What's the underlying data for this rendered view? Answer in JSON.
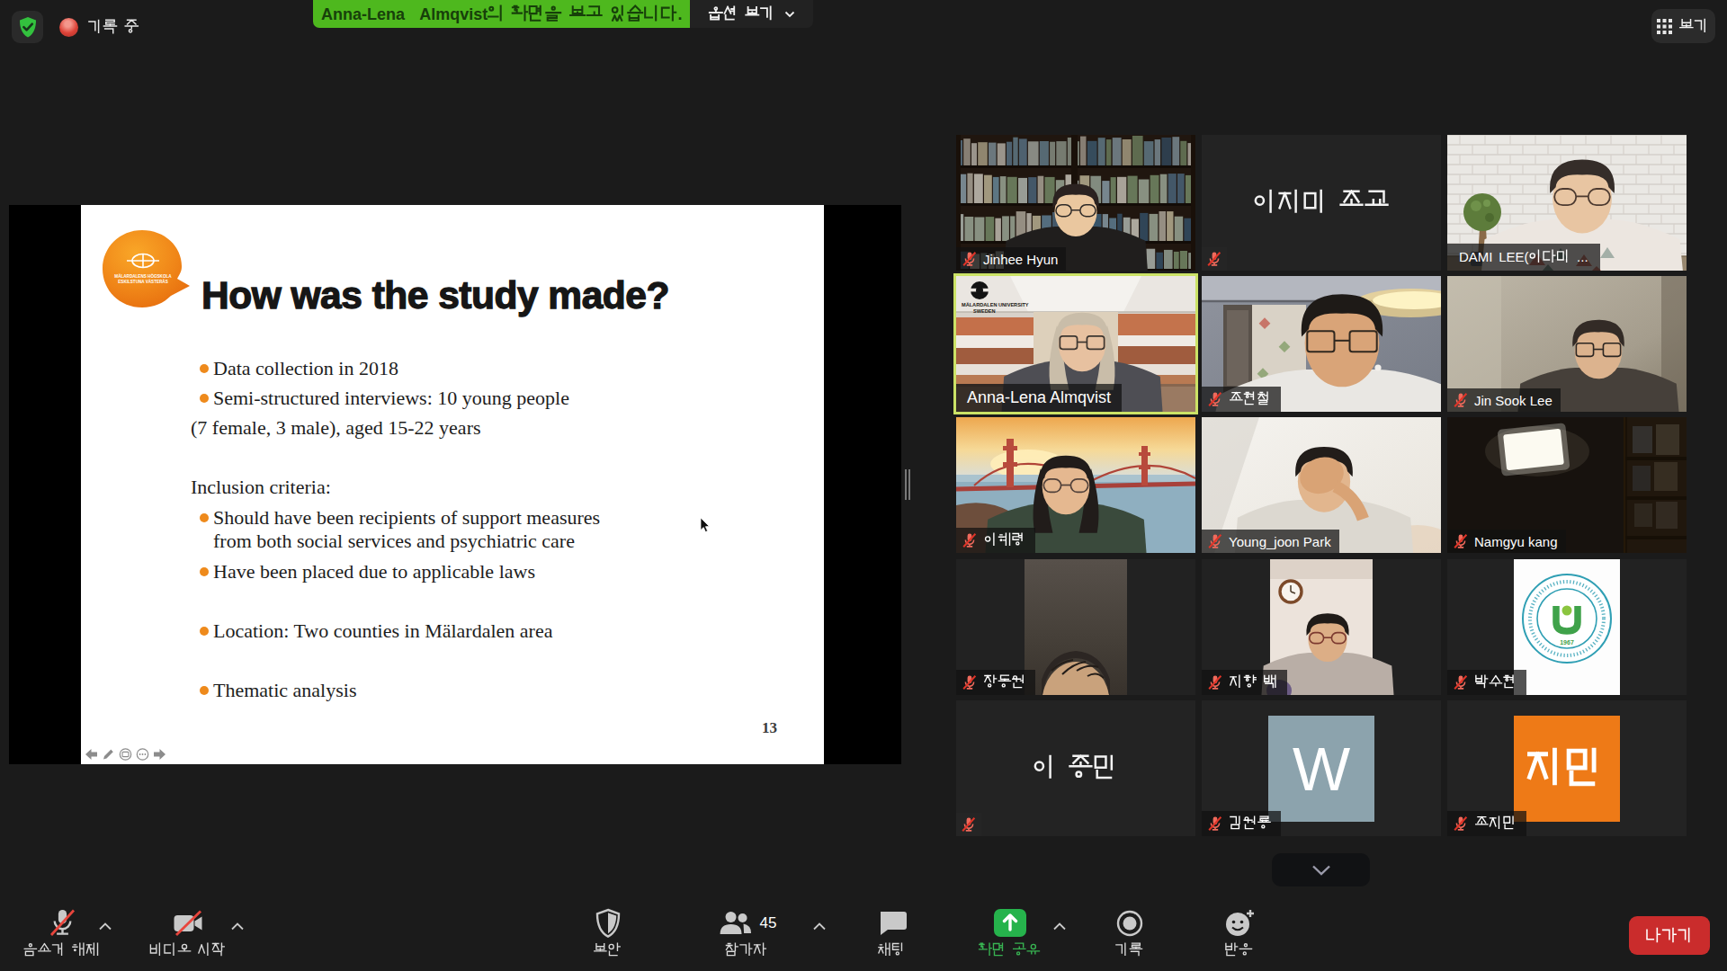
{
  "topbar": {
    "security_icon": "green-shield-check",
    "recording_label": "기록 중",
    "share_banner_text": "Anna-Lena  Almqvist의 화면을 보고 있습니다.",
    "view_options_label": "옵션 보기",
    "view_label": "보기"
  },
  "slide": {
    "logo": {
      "name": "malardalen-hogskola-logo",
      "color": "#ee7d14",
      "lines": [
        "MÄLARDALENS HÖGSKOLA",
        "ESKILSTUNA VÄSTERÅS"
      ]
    },
    "title": "How was the study made?",
    "lines": [
      {
        "bullet": true,
        "text": "Data collection in 2018"
      },
      {
        "bullet": true,
        "text": "Semi-structured interviews: 10 young people"
      },
      {
        "bullet": false,
        "text": "(7 female, 3 male), aged 15-22 years"
      },
      {
        "bullet": false,
        "text": "Inclusion criteria:"
      },
      {
        "bullet": true,
        "text": "Should have been recipients of support measures"
      },
      {
        "bullet": false,
        "text": "from both social services and psychiatric care"
      },
      {
        "bullet": true,
        "text": "Have been placed due to applicable laws"
      },
      {
        "bullet": true,
        "text": "Location: Two counties in Mälardalen area"
      },
      {
        "bullet": true,
        "text": "Thematic analysis"
      }
    ],
    "page_number": "13",
    "nav_icons": [
      "back-arrow-icon",
      "pen-icon",
      "slide-panel-icon",
      "more-options-icon",
      "forward-arrow-icon"
    ]
  },
  "participants": [
    {
      "name": "Jinhee Hyun",
      "muted": true,
      "scene": "bookshelf"
    },
    {
      "name": "이지미 조교",
      "muted": true,
      "scene": "name-only"
    },
    {
      "name": "DAMI LEE(이다미 ...",
      "muted": false,
      "scene": "brick"
    },
    {
      "name": "Anna-Lena Almqvist",
      "muted": false,
      "scene": "atrium",
      "active": true,
      "video_logo": "MÄLARDALEN UNIVERSITY SWEDEN"
    },
    {
      "name": "조현철",
      "muted": true,
      "scene": "dimroom"
    },
    {
      "name": "Jin Sook Lee",
      "muted": true,
      "scene": "beige"
    },
    {
      "name": "이혜령",
      "muted": true,
      "scene": "goldengate"
    },
    {
      "name": "Young_joon Park",
      "muted": true,
      "scene": "whitewall"
    },
    {
      "name": "Namgyu kang",
      "muted": true,
      "scene": "darklight"
    },
    {
      "name": "장동원",
      "muted": true,
      "scene": "porthead"
    },
    {
      "name": "지향 백",
      "muted": true,
      "scene": "portclock"
    },
    {
      "name": "박수현",
      "muted": true,
      "scene": "logocard",
      "card_logo_text": "1967"
    },
    {
      "name": "이 종민",
      "muted": true,
      "scene": "name-only"
    },
    {
      "name": "김원룡",
      "muted": true,
      "scene": "avatar",
      "avatar_text": "W",
      "avatar_color": "#8ca3ad"
    },
    {
      "name": "조지민",
      "muted": true,
      "scene": "avatar",
      "avatar_text": "지민",
      "avatar_color": "#ee7a17"
    }
  ],
  "grid_more_icon": "chevron-down-icon",
  "toolbar": {
    "mute": {
      "label": "음소거 해제",
      "icon": "muted-mic-icon",
      "menu": true
    },
    "video": {
      "label": "비디오 시작",
      "icon": "muted-camera-icon",
      "menu": true
    },
    "security": {
      "label": "보안",
      "icon": "shield-icon"
    },
    "participants": {
      "label": "참가자",
      "count": "45",
      "icon": "participants-icon",
      "menu": true
    },
    "chat": {
      "label": "채팅",
      "icon": "chat-bubble-icon"
    },
    "share": {
      "label": "화면 공유",
      "icon": "share-screen-icon",
      "menu": true,
      "accent": "#26b34c"
    },
    "record": {
      "label": "기록",
      "icon": "record-icon"
    },
    "reactions": {
      "label": "반응",
      "icon": "reactions-icon"
    },
    "leave": {
      "label": "나가기",
      "color": "#ca2c2c"
    }
  }
}
